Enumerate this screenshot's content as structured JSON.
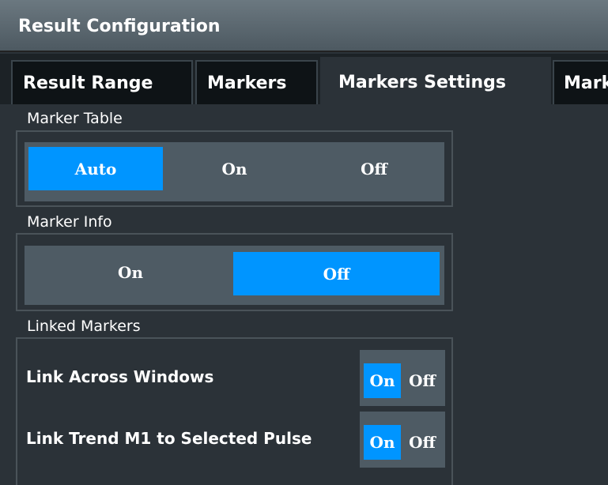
{
  "window": {
    "title": "Result Configuration"
  },
  "tabs": [
    {
      "label": "Result Range",
      "active": false
    },
    {
      "label": "Markers",
      "active": false
    },
    {
      "label": "Markers Settings",
      "active": true
    },
    {
      "label": "Marker",
      "active": false
    }
  ],
  "marker_table": {
    "label": "Marker Table",
    "options": [
      "Auto",
      "On",
      "Off"
    ],
    "selected": "Auto"
  },
  "marker_info": {
    "label": "Marker Info",
    "options": [
      "On",
      "Off"
    ],
    "selected": "Off"
  },
  "linked_markers": {
    "label": "Linked Markers",
    "rows": [
      {
        "label": "Link Across Windows",
        "on_label": "On",
        "off_label": "Off",
        "state": "On"
      },
      {
        "label": "Link Trend M1 to Selected Pulse",
        "on_label": "On",
        "off_label": "Off",
        "state": "On"
      }
    ]
  },
  "colors": {
    "accent": "#0095ff",
    "panel_bg": "#2b3238",
    "control_bg": "#4e5b64"
  }
}
